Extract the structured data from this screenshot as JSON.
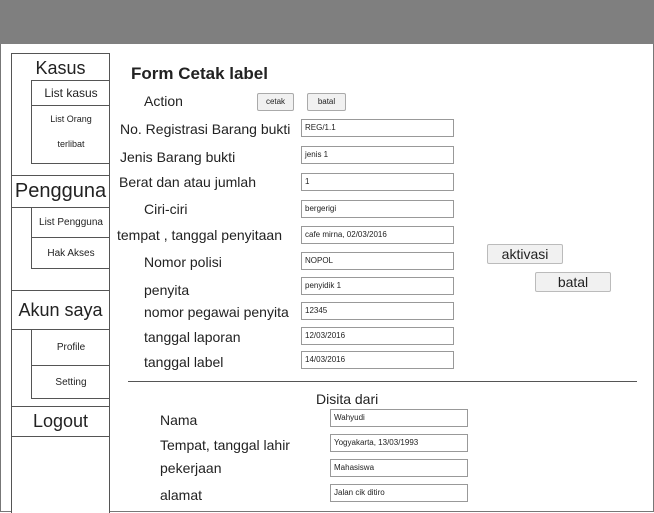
{
  "sidebar": {
    "kasus": "Kasus",
    "list_kasus": "List kasus",
    "list_orang": "List Orang",
    "terlibat": "terlibat",
    "pengguna": "Pengguna",
    "list_pengguna": "List Pengguna",
    "hak_akses": "Hak Akses",
    "akun_saya": "Akun saya",
    "profile": "Profile",
    "setting": "Setting",
    "logout": "Logout"
  },
  "form": {
    "title": "Form Cetak label",
    "action_label": "Action",
    "cetak": "cetak",
    "batal_small": "batal",
    "fields": [
      {
        "label": "No. Registrasi Barang bukti",
        "value": "REG/1.1"
      },
      {
        "label": "Jenis Barang bukti",
        "value": "jenis 1"
      },
      {
        "label": "Berat dan atau jumlah",
        "value": "1"
      },
      {
        "label": "Ciri-ciri",
        "value": "bergerigi"
      },
      {
        "label": "tempat , tanggal penyitaan",
        "value": "cafe mirna, 02/03/2016"
      },
      {
        "label": "Nomor polisi",
        "value": "NOPOL"
      },
      {
        "label": "penyita",
        "value": "penyidik 1"
      },
      {
        "label": "nomor pegawai penyita",
        "value": "12345"
      },
      {
        "label": "tanggal laporan",
        "value": "12/03/2016"
      },
      {
        "label": "tanggal label",
        "value": "14/03/2016"
      }
    ],
    "aktivasi": "aktivasi",
    "batal_big": "batal",
    "section_title": "Disita dari",
    "person": [
      {
        "label": "Nama",
        "value": "Wahyudi"
      },
      {
        "label": "Tempat, tanggal lahir",
        "value": "Yogyakarta, 13/03/1993"
      },
      {
        "label": "pekerjaan",
        "value": "Mahasiswa"
      },
      {
        "label": "alamat",
        "value": "Jalan cik ditiro"
      }
    ]
  }
}
